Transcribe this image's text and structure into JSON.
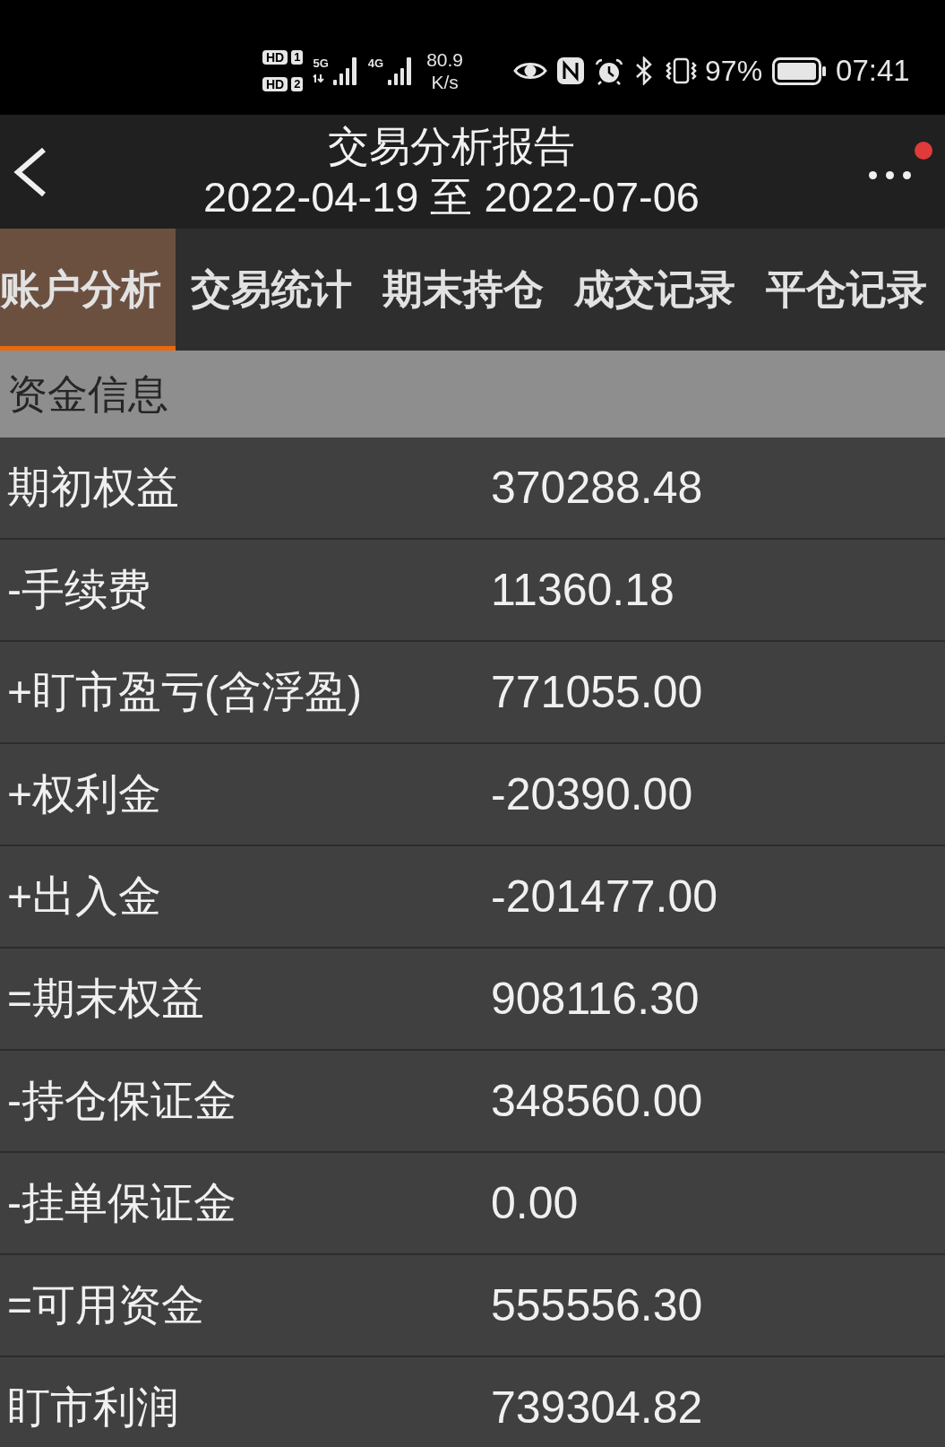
{
  "status_bar": {
    "sims": [
      {
        "label": "HD",
        "slot": "1"
      },
      {
        "label": "HD",
        "slot": "2"
      }
    ],
    "signals": [
      {
        "network": "5G",
        "data_activity": true
      },
      {
        "network": "4G",
        "data_activity": false
      }
    ],
    "speed": {
      "value": "80.9",
      "unit": "K/s"
    },
    "battery": "97%",
    "time": "07:41"
  },
  "header": {
    "title": "交易分析报告",
    "subtitle": "2022-04-19 至 2022-07-06",
    "notification_dot": true
  },
  "tabs": [
    {
      "label": "账户分析",
      "selected": true
    },
    {
      "label": "交易统计",
      "selected": false
    },
    {
      "label": "期末持仓",
      "selected": false
    },
    {
      "label": "成交记录",
      "selected": false
    },
    {
      "label": "平仓记录",
      "selected": false
    }
  ],
  "section": {
    "title": "资金信息"
  },
  "rows": [
    {
      "label": "期初权益",
      "value": "370288.48"
    },
    {
      "label": "-手续费",
      "value": "11360.18"
    },
    {
      "label": "+盯市盈亏(含浮盈)",
      "value": "771055.00"
    },
    {
      "label": "+权利金",
      "value": "-20390.00"
    },
    {
      "label": "+出入金",
      "value": "-201477.00"
    },
    {
      "label": "=期末权益",
      "value": "908116.30"
    },
    {
      "label": "-持仓保证金",
      "value": "348560.00"
    },
    {
      "label": "-挂单保证金",
      "value": "0.00"
    },
    {
      "label": "=可用资金",
      "value": "555556.30"
    },
    {
      "label": "盯市利润",
      "value": "739304.82"
    }
  ]
}
